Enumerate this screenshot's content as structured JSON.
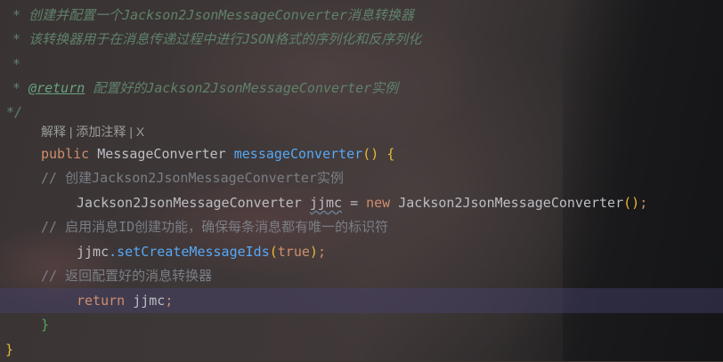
{
  "javadoc": {
    "line1_star": "*",
    "line1_text": "创建并配置一个Jackson2JsonMessageConverter消息转换器",
    "line2_star": "*",
    "line2_text": "该转换器用于在消息传递过程中进行JSON格式的序列化和反序列化",
    "line3_star": "*",
    "line4_star": "*",
    "line4_tag": "@return",
    "line4_text": "配置好的Jackson2JsonMessageConverter实例",
    "close": "*/"
  },
  "inlay_hints": {
    "explain": "解释",
    "sep1": "|",
    "add_comment": "添加注释",
    "sep2": "|",
    "close": "X"
  },
  "code": {
    "method_public": "public",
    "method_type": "MessageConverter",
    "method_name": "messageConverter",
    "method_parens": "()",
    "method_open_brace": "{",
    "comment1": "// 创建Jackson2JsonMessageConverter实例",
    "decl_type": "Jackson2JsonMessageConverter",
    "decl_var": "jjmc",
    "decl_eq": "=",
    "decl_new": "new",
    "decl_ctor": "Jackson2JsonMessageConverter",
    "decl_ctor_parens": "()",
    "decl_semi": ";",
    "comment2": "// 启用消息ID创建功能，确保每条消息都有唯一的标识符",
    "call_obj": "jjmc",
    "call_method": ".setCreateMessageIds",
    "call_open": "(",
    "call_arg": "true",
    "call_close": ")",
    "call_semi": ";",
    "comment3": "// 返回配置好的消息转换器",
    "return_kw": "return",
    "return_var": "jjmc",
    "return_semi": ";",
    "method_close_brace": "}",
    "class_close_brace": "}"
  },
  "colors": {
    "keyword": "#cf8e6d",
    "method": "#56a8f5",
    "comment": "#7a7e85",
    "doc_comment": "#5f826b",
    "bracket_gold": "#e8ba36",
    "bracket_green": "#54a857",
    "caret_row": "#46426e"
  }
}
